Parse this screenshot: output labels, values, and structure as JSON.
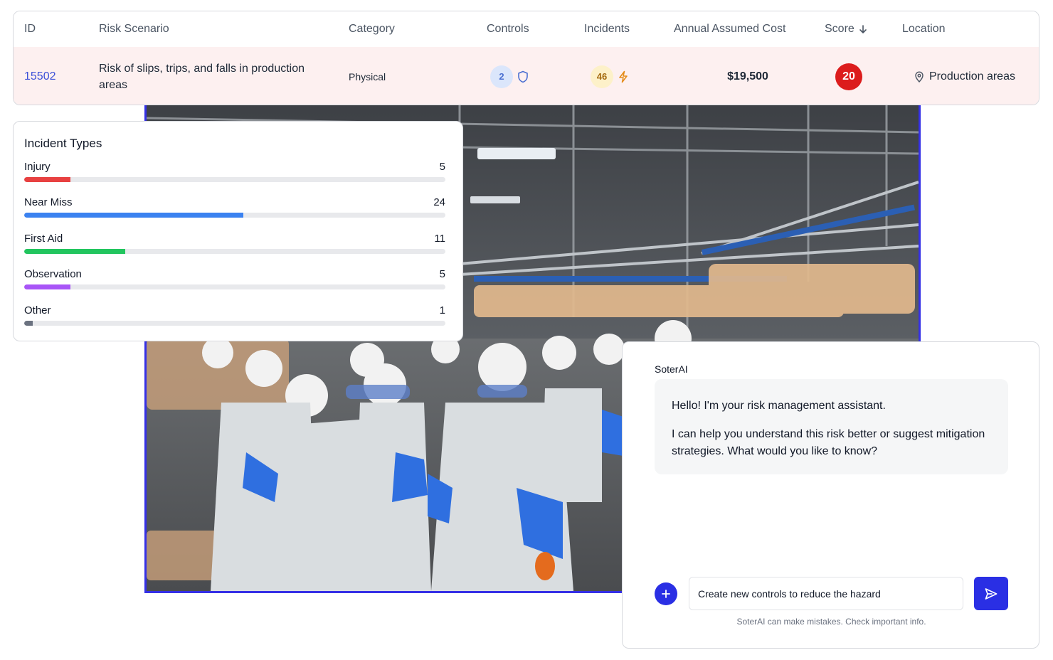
{
  "table": {
    "headers": {
      "id": "ID",
      "scenario": "Risk Scenario",
      "category": "Category",
      "controls": "Controls",
      "incidents": "Incidents",
      "cost": "Annual Assumed Cost",
      "score": "Score",
      "location": "Location"
    },
    "row": {
      "id": "15502",
      "scenario": "Risk of slips, trips, and falls in production areas",
      "category": "Physical",
      "controls": "2",
      "incidents": "46",
      "cost": "$19,500",
      "score": "20",
      "location": "Production areas"
    },
    "icons": {
      "sort": "arrow-down-icon",
      "controls": "shield-icon",
      "incidents": "lightning-icon",
      "location": "map-pin-icon"
    },
    "colors": {
      "row_highlight": "#fdf0f0",
      "id_link": "#3b4fd8",
      "score_badge": "#dc1c1c"
    }
  },
  "incident_types": {
    "title": "Incident Types",
    "items": [
      {
        "label": "Injury",
        "count": "5",
        "fraction": 0.11,
        "color": "#e84141"
      },
      {
        "label": "Near Miss",
        "count": "24",
        "fraction": 0.52,
        "color": "#3b82f0"
      },
      {
        "label": "First Aid",
        "count": "11",
        "fraction": 0.24,
        "color": "#22c55e"
      },
      {
        "label": "Observation",
        "count": "5",
        "fraction": 0.11,
        "color": "#a855f7"
      },
      {
        "label": "Other",
        "count": "1",
        "fraction": 0.02,
        "color": "#6b7280"
      }
    ]
  },
  "chat": {
    "assistant_name": "SoterAI",
    "messages": [
      "Hello! I'm your risk management assistant.",
      "I can help you understand this risk better or suggest mitigation strategies. What would you like to know?"
    ],
    "input_value": "Create new controls to reduce the hazard",
    "disclaimer": "SoterAI can make mistakes. Check important info.",
    "accent": "#2a2fe4"
  }
}
